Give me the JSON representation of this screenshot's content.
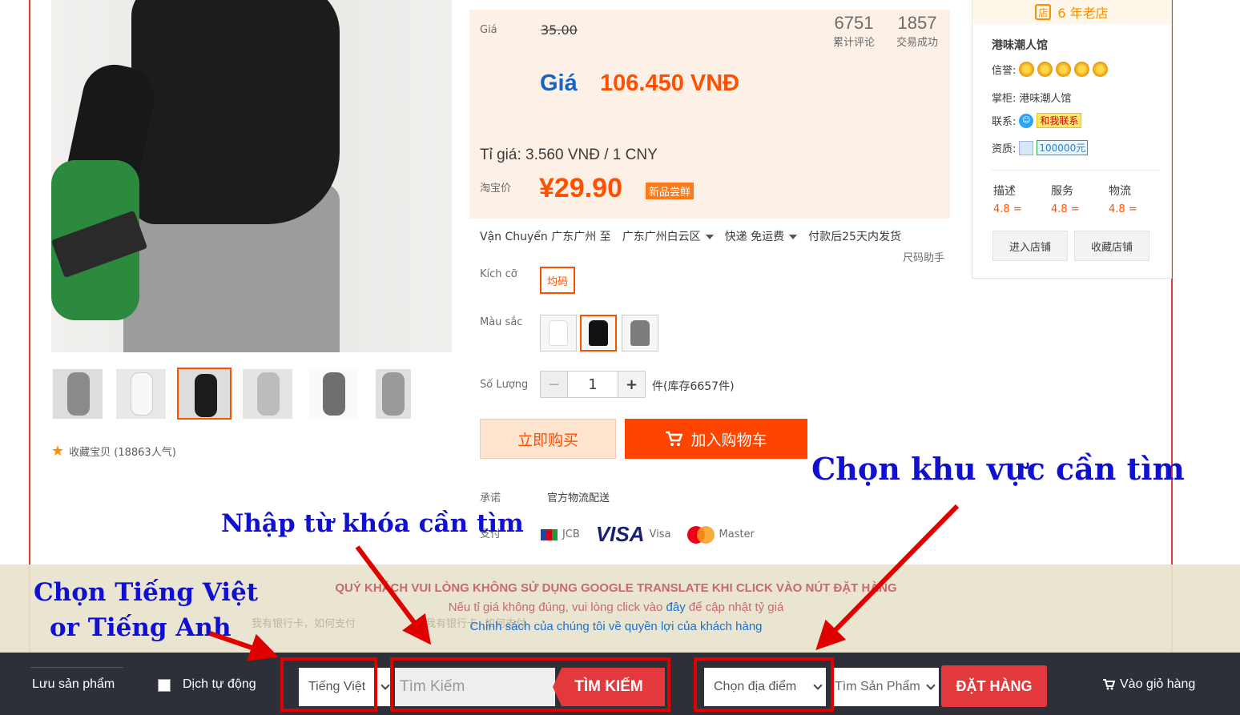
{
  "product": {
    "favorite_label": "收藏宝贝 (18863人气)",
    "thumbnails": [
      "#8a8a8a",
      "#f0f0f0",
      "#1c1c1c",
      "#bfbfbf",
      "#6f6f6f",
      "#9a9a9a"
    ]
  },
  "price": {
    "label": "Giá",
    "old_price": "35.00",
    "reviews_count": "6751",
    "reviews_label": "累计评论",
    "sales_count": "1857",
    "sales_label": "交易成功",
    "gia_label": "Giá",
    "vnd_price": "106.450 VNĐ",
    "exchange_rate": "Tỉ giá: 3.560 VNĐ / 1 CNY",
    "taobao_label": "淘宝价",
    "taobao_price": "¥29.90",
    "new_badge": "新品尝鲜"
  },
  "shipping": {
    "label": "Vận Chuyển",
    "from": "广东广州 至",
    "to": "广东广州白云区",
    "method": "快递 免运费",
    "dispatch": "付款后25天内发货",
    "size_helper": "尺码助手"
  },
  "options": {
    "size_label": "Kích cỡ",
    "size_value": "均码",
    "color_label": "Màu sắc",
    "colors": [
      "#ffffff",
      "#111111",
      "#7c7c7c"
    ],
    "qty_label": "Số Lượng",
    "qty_minus": "−",
    "qty_value": "1",
    "qty_plus": "+",
    "stock": "件(库存6657件)"
  },
  "actions": {
    "buy_now": "立即购买",
    "add_to_cart": "加入购物车"
  },
  "promise": {
    "promise_label": "承诺",
    "promise_value": "官方物流配送",
    "pay_label": "支付",
    "jcb": "JCB",
    "visa_logo": "VISA",
    "visa": "Visa",
    "master": "Master"
  },
  "shop": {
    "years": "6 年老店",
    "name": "港味潮人馆",
    "credit_label": "信誉:",
    "owner_label": "掌柜:",
    "owner": "港味潮人馆",
    "contact_label": "联系:",
    "contact_btn": "和我联系",
    "qualify_label": "资质:",
    "deposit": "100000元",
    "ratings": [
      {
        "label": "描述",
        "value": "4.8 ="
      },
      {
        "label": "服务",
        "value": "4.8 ="
      },
      {
        "label": "物流",
        "value": "4.8 ="
      }
    ],
    "enter_shop": "进入店铺",
    "favorite_shop": "收藏店铺"
  },
  "notice": {
    "warning": "QUÝ KHÁCH VUI LÒNG KHÔNG SỬ DỤNG GOOGLE TRANSLATE KHI CLICK VÀO NÚT ĐẶT HÀNG",
    "rate_prefix": "Nếu tỉ giá không đúng, vui lòng click vào",
    "rate_link": "đây",
    "rate_suffix": "để cập nhật tỷ giá",
    "policy": "Chính sách của chúng tôi về quyền lợi của khách hàng",
    "ghost_1": "我有银行卡，如何支付",
    "ghost_2": "我有银行卡",
    "ghost_3": "如何支付"
  },
  "toolbar": {
    "save_product": "Lưu sản phẩm",
    "auto_translate": "Dịch tự động",
    "language": "Tiếng Việt",
    "search_placeholder": "Tìm Kiếm",
    "search_button": "TÌM KIẾM",
    "location": "Chọn địa điểm",
    "find_product": "Tìm Sản Phẩm",
    "order_button": "ĐẶT HÀNG",
    "cart_link": "Vào giỏ hàng"
  },
  "annotations": {
    "choose_language_1": "Chọn Tiếng Việt",
    "choose_language_2": "or Tiếng Anh",
    "enter_keyword": "Nhập từ khóa cần tìm",
    "choose_region": "Chọn khu vực cần tìm"
  }
}
